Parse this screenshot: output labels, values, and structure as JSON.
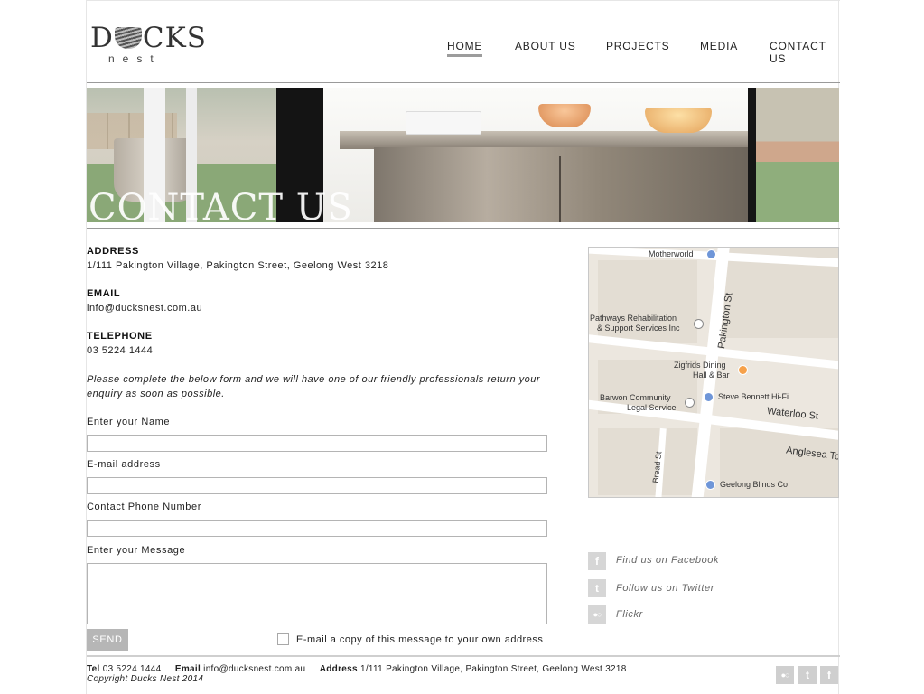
{
  "brand": {
    "word_left": "D",
    "word_right": "CKS",
    "sub": "nest"
  },
  "nav": [
    {
      "label": "HOME",
      "active": true
    },
    {
      "label": "ABOUT US"
    },
    {
      "label": "PROJECTS"
    },
    {
      "label": "MEDIA"
    },
    {
      "label": "CONTACT US"
    }
  ],
  "hero": {
    "title": "CONTACT US"
  },
  "contact": {
    "address_label": "ADDRESS",
    "address": "1/111 Pakington Village, Pakington Street, Geelong West 3218",
    "email_label": "EMAIL",
    "email": "info@ducksnest.com.au",
    "telephone_label": "TELEPHONE",
    "telephone": "03 5224 1444",
    "intro": "Please complete the below form and we will have one of our friendly professionals return your enquiry as soon as possible."
  },
  "form": {
    "name_label": "Enter your Name",
    "name_value": "",
    "email_label": "E-mail address",
    "email_value": "",
    "phone_label": "Contact Phone Number",
    "phone_value": "",
    "message_label": "Enter your Message",
    "message_value": "",
    "send_label": "SEND",
    "copy_label": "E-mail a copy of this message to your own address",
    "copy_checked": false
  },
  "map": {
    "places": [
      "Motherworld",
      "Pathways Rehabilitation",
      "& Support Services Inc",
      "Zigfrids Dining",
      "Hall & Bar",
      "Barwon Community",
      "Legal Service",
      "Steve Bennett Hi-Fi",
      "Geelong Blinds Co"
    ],
    "streets": [
      "Pakington St",
      "Waterloo St",
      "Anglesea Tc",
      "Bread St"
    ]
  },
  "social": [
    {
      "icon": "facebook-icon",
      "glyph": "f",
      "label": "Find us on Facebook"
    },
    {
      "icon": "twitter-icon",
      "glyph": "t",
      "label": "Follow us on Twitter"
    },
    {
      "icon": "flickr-icon",
      "glyph": "●○",
      "label": "Flickr"
    }
  ],
  "footer": {
    "tel_label": "Tel",
    "tel": "03 5224 1444",
    "email_label": "Email",
    "email": "info@ducksnest.com.au",
    "address_label": "Address",
    "address": "1/111 Pakington Village, Pakington Street, Geelong West 3218",
    "copyright": "Copyright Ducks Nest 2014",
    "icons": [
      {
        "icon": "flickr-icon",
        "glyph": "●○"
      },
      {
        "icon": "twitter-icon",
        "glyph": "t"
      },
      {
        "icon": "facebook-icon",
        "glyph": "f"
      }
    ]
  },
  "colors": {
    "rule": "#9a9a9a",
    "button": "#b6b6b6",
    "social": "#d6d6d6",
    "map_bg": "#ece7df"
  }
}
